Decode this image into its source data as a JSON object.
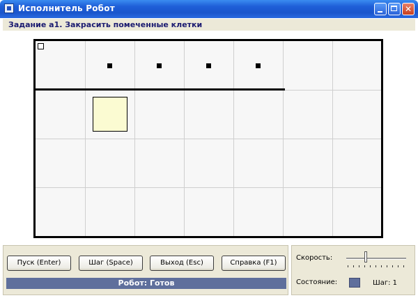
{
  "window": {
    "title": "Исполнитель Робот"
  },
  "task": {
    "text": "Задание а1. Закрасить помеченные клетки"
  },
  "field": {
    "columns": 7,
    "rows": 4,
    "marked_cells": [
      [
        0,
        1
      ],
      [
        0,
        2
      ],
      [
        0,
        3
      ],
      [
        0,
        4
      ]
    ],
    "painted_cells": [
      [
        1,
        1
      ]
    ],
    "robot_cell": [
      0,
      0
    ]
  },
  "buttons": {
    "start": "Пуск (Enter)",
    "step": "Шаг (Space)",
    "exit": "Выход (Esc)",
    "help": "Справка (F1)"
  },
  "status": {
    "text": "Робот: Готов"
  },
  "side": {
    "speed_label": "Скорость:",
    "state_label": "Состояние:",
    "step_text": "Шаг: 1",
    "speed_level": 0.35
  },
  "colors": {
    "titlebar": "#1f5fd8",
    "status_bar": "#5f6f9c",
    "painted_cell": "#fbfbd2"
  }
}
